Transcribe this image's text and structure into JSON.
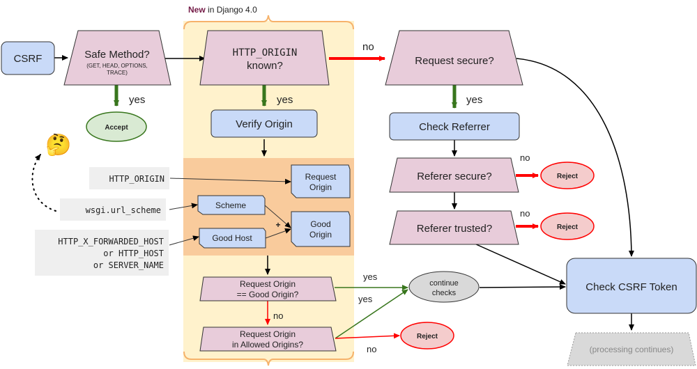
{
  "diagram": {
    "header": {
      "new_label": "New",
      "rest_label": " in Django 4.0"
    },
    "colors": {
      "pink_fill": "#e8ccda",
      "blue_fill": "#c9daf8",
      "green_fill": "#d9ead3",
      "green_stroke": "#38761d",
      "red_fill": "#f4cccc",
      "red_stroke": "#ff0000",
      "yellow_bg": "#fff2cc",
      "orange_bg": "#f9cb9c",
      "orange_brace": "#f6b26b",
      "gray_fill": "#d9d9d9",
      "code_bg": "#efefef"
    },
    "nodes": {
      "csrf": "CSRF",
      "safe_method": "Safe Method?",
      "safe_method_sub1": "(GET, HEAD, OPTIONS,",
      "safe_method_sub2": "TRACE)",
      "accept": "Accept",
      "origin_known_1": "HTTP_ORIGIN",
      "origin_known_2": "known?",
      "verify_origin": "Verify Origin",
      "request_origin_1": "Request",
      "request_origin_2": "Origin",
      "scheme": "Scheme",
      "good_host": "Good Host",
      "good_origin_1": "Good",
      "good_origin_2": "Origin",
      "eq_1": "Request Origin",
      "eq_2": "== Good Origin?",
      "allowed_1": "Request Origin",
      "allowed_2": "in Allowed Origins?",
      "continue_1": "continue",
      "continue_2": "checks",
      "reject": "Reject",
      "request_secure": "Request secure?",
      "check_referrer": "Check Referrer",
      "referer_secure": "Referer secure?",
      "referer_trusted": "Referer trusted?",
      "check_token": "Check CSRF Token",
      "processing": "(processing continues)"
    },
    "inputs": {
      "http_origin": "HTTP_ORIGIN",
      "url_scheme": "wsgi.url_scheme",
      "host_1": "HTTP_X_FORWARDED_HOST",
      "host_2": "or HTTP_HOST",
      "host_3": "or SERVER_NAME"
    },
    "edge_labels": {
      "yes": "yes",
      "no": "no",
      "plus": "+"
    },
    "emoji": {
      "thinking": "🤔"
    }
  }
}
